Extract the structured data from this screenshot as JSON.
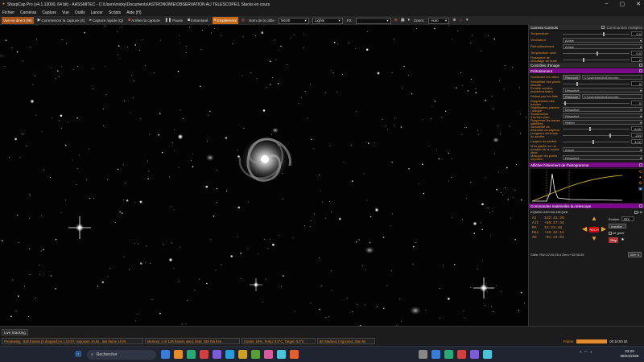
{
  "window": {
    "title": "SharpCap Pro (v4.1.13000, 64 bit) - AASSMITEC - C:\\Users\\micky\\Documents\\ASTRONOMIE\\OBSERVATION AU TELESCOPE\\1 Stacks en cours"
  },
  "menu": [
    "Fichier",
    "Caméras",
    "Capture",
    "Vue",
    "Outils",
    "Lancer",
    "Scripts",
    "Aide (H)"
  ],
  "toolbar": {
    "live": "Vue en direct (W)",
    "start_capture": "Commencer la capture (S)",
    "quick_capture": "Capture rapide (Q)",
    "stop_capture": "Arrêter la capture",
    "pause": "Pause",
    "snapshot": "Instantané",
    "stacking": "Empilement",
    "target_label": "Nom de la cible",
    "target_value": "M100",
    "frame_type": "Lights",
    "fx_label": "FX",
    "zoom_label": "Zoom:",
    "zoom_value": "Auto"
  },
  "panel": {
    "camera_controls": {
      "title": "Camera Controls",
      "checkbox": "Commandes multiples",
      "rows": [
        {
          "label": "Température",
          "value": "0.0"
        },
        {
          "label": "Ventilateur",
          "select": "Activé"
        },
        {
          "label": "Refroidissement",
          "select": "Activé"
        },
        {
          "label": "Température cible",
          "value": "0.0"
        },
        {
          "label": "Puissance de chauffage de buée",
          "value": "2"
        }
      ]
    },
    "image_controls": {
      "title": "Contrôles d'image"
    },
    "preprocessing": {
      "title": "Prétraitement",
      "rows": [
        {
          "label": "Soustraire les darks",
          "button": "Parcourir",
          "path": "C:\\Users\\micky\\Docume..."
        },
        {
          "label": "Sensibilité des pixels chauds",
          "value": "5"
        },
        {
          "label": "Échelle sombre (expérimentale)",
          "select": "Désactivé"
        },
        {
          "label": "Diviser par les flats",
          "button": "Parcourir",
          "path": "C:\\Users\\micky\\Docume..."
        },
        {
          "label": "Suppression des bandes",
          "value": "0"
        },
        {
          "label": "Stabilisation planète / disque",
          "select": "Désactivé"
        },
        {
          "label": "Soustraction d'arrière-plan",
          "select": "Désactivé"
        },
        {
          "label": "Supprimer les traces satellites",
          "select": "Retirer"
        },
        {
          "label": "Sensibilité de détection du capteur",
          "value": "8.60"
        },
        {
          "label": "Longueur minimale du sentier",
          "value": "234"
        },
        {
          "label": "Largeur du sentier",
          "value": "4.22"
        },
        {
          "label": "N'en garder en un nombre de la courte ideal",
          "select": "Aucun"
        },
        {
          "label": "Masquer les pixels exposés",
          "select": "Désactivé"
        }
      ]
    },
    "histogram": {
      "title": "Afficher l'étirement de l'histogramme"
    },
    "telescope": {
      "title": "Commandes matérielles du télescope",
      "mount": "EQMOD ASCOM HEQ5/6",
      "live_check": "Lié",
      "coords": [
        {
          "k": "Az",
          "v": "142:41:25"
        },
        {
          "k": "Alt",
          "v": "+55:17:34"
        },
        {
          "k": "RA",
          "v": "12:23:48"
        },
        {
          "k": "Dec",
          "v": "+15:42:12"
        },
        {
          "k": "AH",
          "v": "-01:24:01"
        }
      ],
      "center_btn": "RECH",
      "evaluate": "Évaluer",
      "rate": "32x",
      "install": "Installer",
      "park_check": "se garer",
      "stop_btn": "Stop",
      "target_line": "Cible:  RA=12:24:16.4 Dec=+15:40:25",
      "goto_btn": "Aller à"
    }
  },
  "status": {
    "live_stacking": "Live Stacking",
    "preview": "Previewing : 625 frames (0 dropped) in 1:10:07, exposure 10.0s , last frame 10.0s",
    "memory": "Memory: 4 of 129 frames used, Disk: 339 GB free",
    "cooler": "Cooler: 24%, Temp: 0.0°C, Target: 0.0°C",
    "stacked": "80 Stacked, 0 Ignored, 30m 9s",
    "frame_label": "Frame:",
    "elapsed": "00:10:00.00"
  },
  "taskbar": {
    "search": "Rechercher",
    "time": "23:29",
    "date": "08/04/2026"
  },
  "colors": {
    "accent": "#e38b2d",
    "purple": "#7a0a8a",
    "orange_btn": "#c46a18"
  }
}
